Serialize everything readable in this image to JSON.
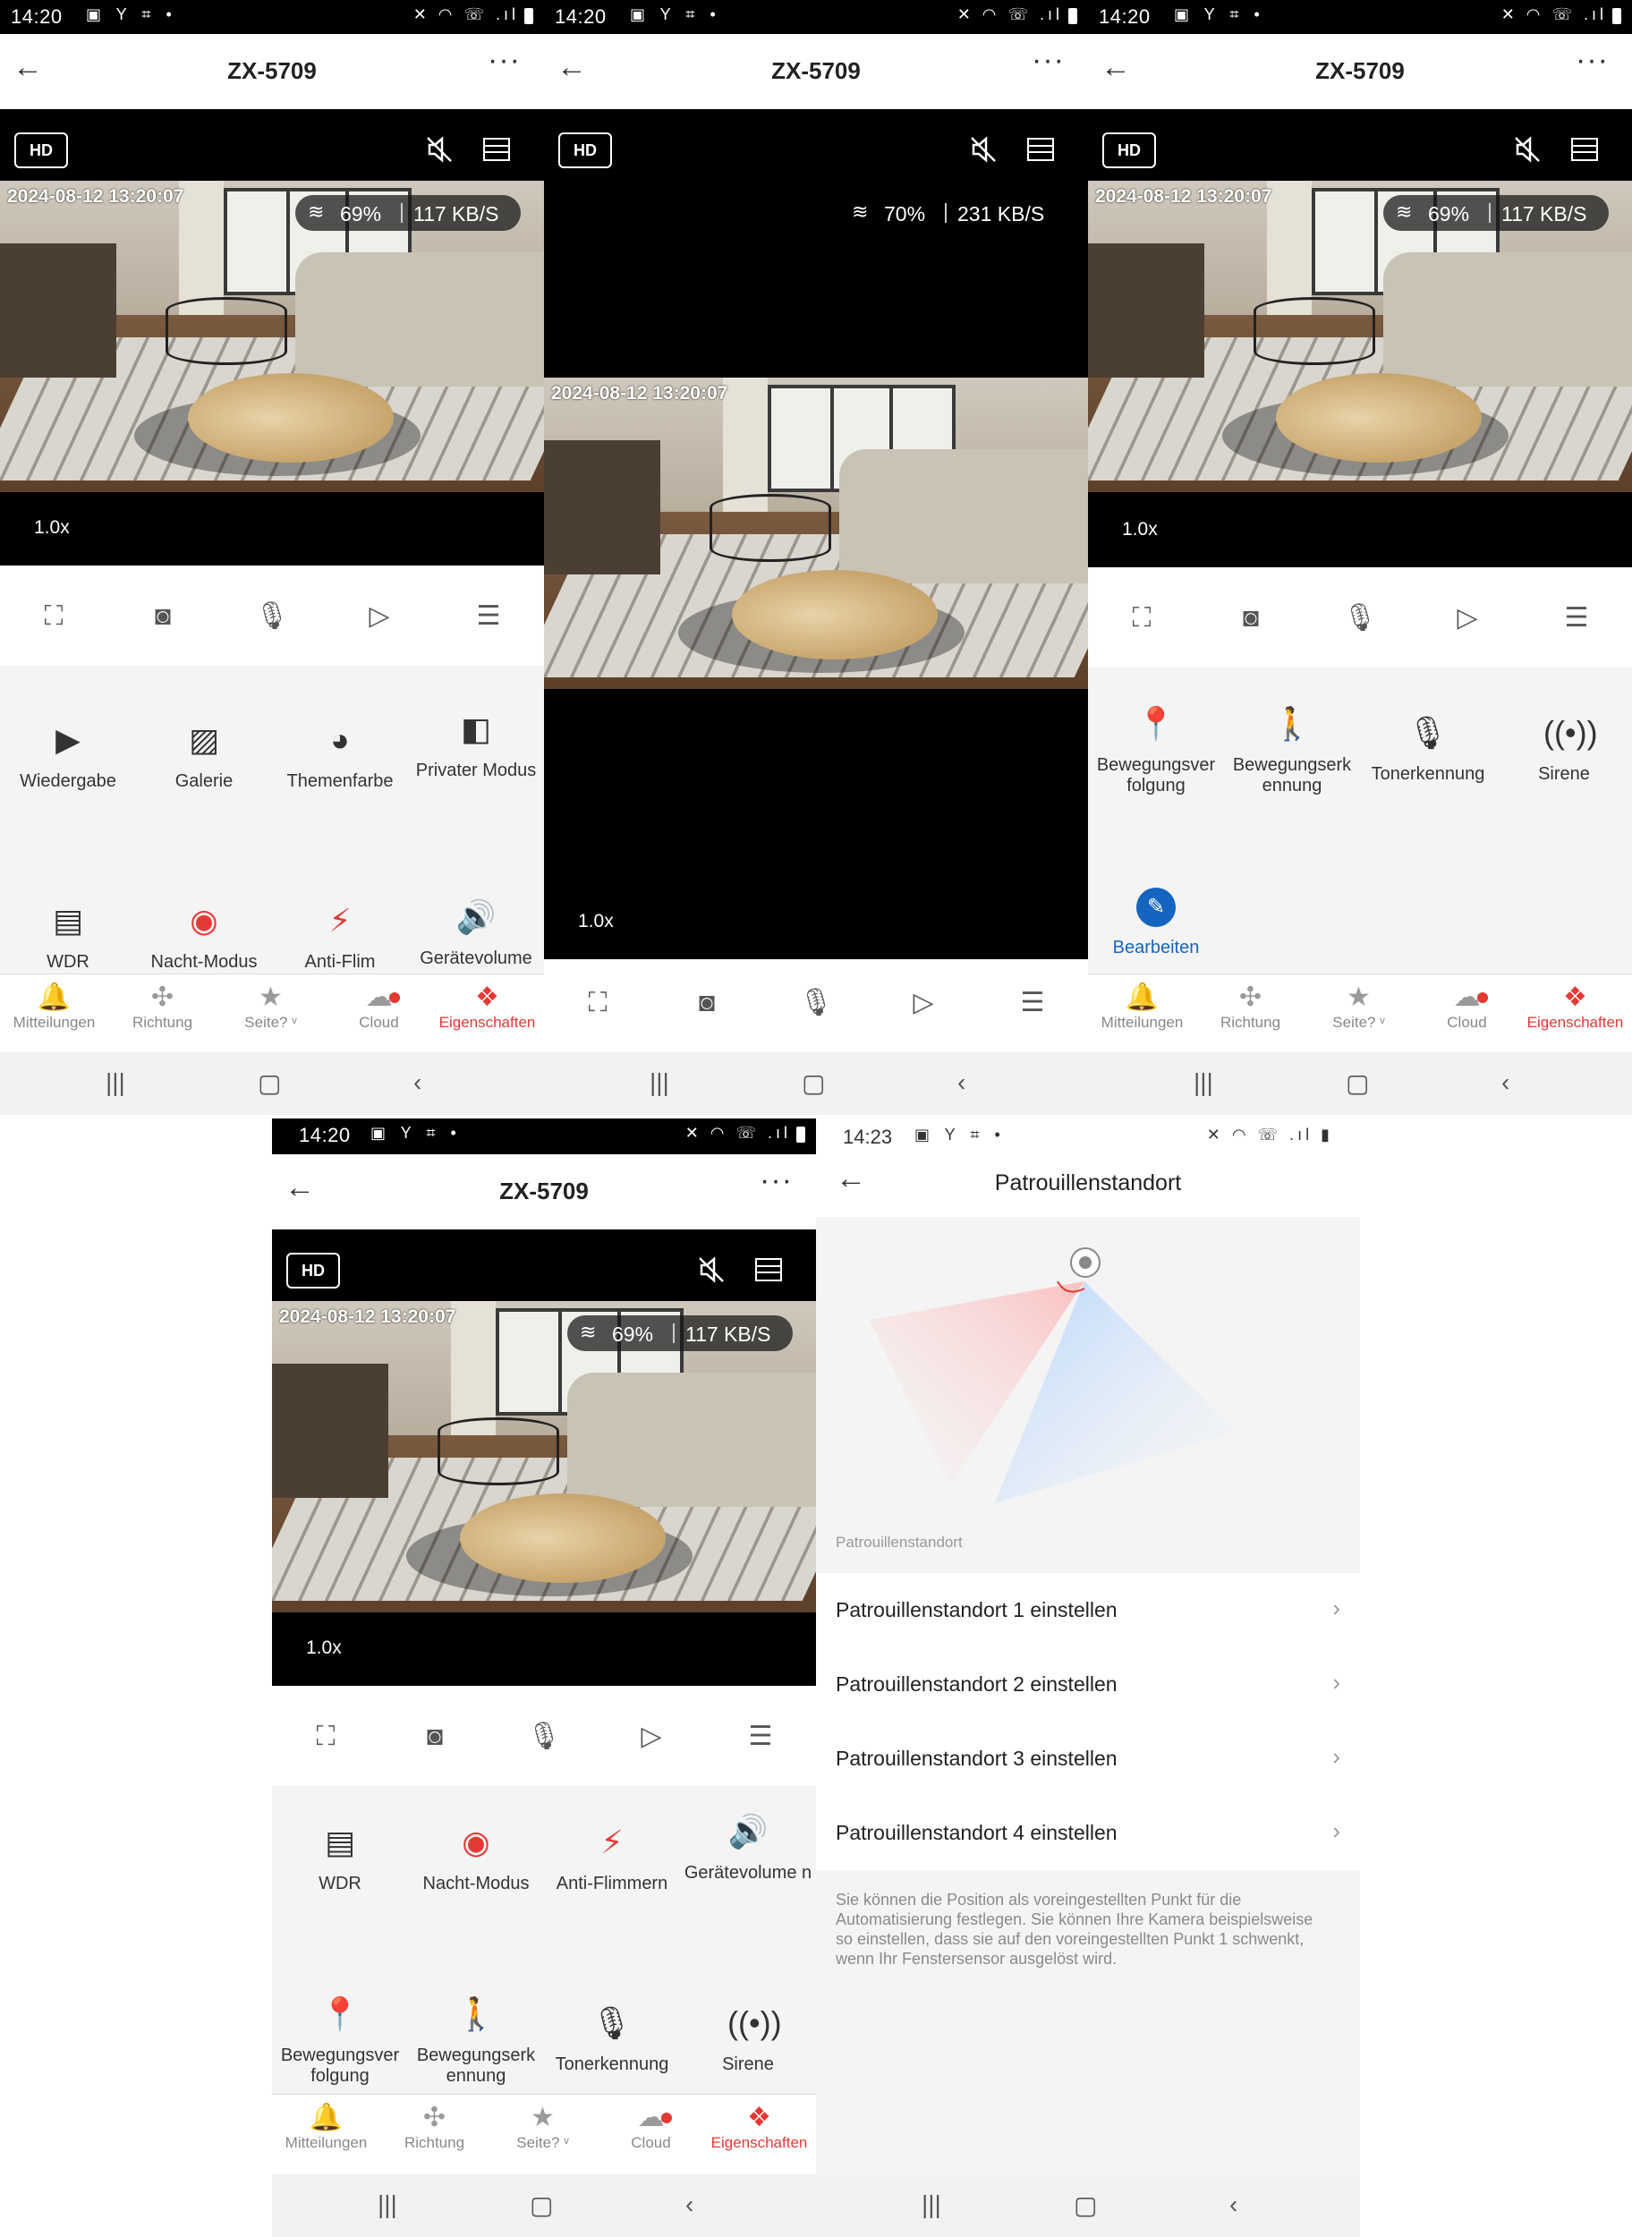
{
  "status": {
    "time": "14:20",
    "time_last": "14:23"
  },
  "appbar": {
    "title": "ZX-5709"
  },
  "video": {
    "quality": "HD",
    "timestamp": "2024-08-12   13:20:07",
    "signal_a": "69%",
    "rate_a": "117 KB/S",
    "signal_b": "70%",
    "rate_b": "231 KB/S",
    "zoom": "1.0x"
  },
  "features": {
    "wiedergabe": "Wiedergabe",
    "galerie": "Galerie",
    "themenfarbe": "Themenfarbe",
    "privater_modus": "Privater Modus",
    "wdr": "WDR",
    "nacht_modus": "Nacht-Modus",
    "anti_flimmern": "Anti-Flimmern",
    "geraetevolume": "Gerätevolume n",
    "geraetevolume_partial": "Gerätevolume",
    "bewegungsverfolgung": "Bewegungsver folgung",
    "bewegungserkennung": "Bewegungserk ennung",
    "tonerkennung": "Tonerkennung",
    "sirene": "Sirene",
    "bearbeiten": "Bearbeiten",
    "wdr_partial": "WDR",
    "nacht_partial": "Nacht-Modus",
    "anti_partial": "Anti-Flim"
  },
  "tabs": {
    "mitteilungen": "Mitteilungen",
    "richtung": "Richtung",
    "seite": "Seite? ᵛ",
    "cloud": "Cloud",
    "eigenschaften": "Eigenschaften"
  },
  "patrol": {
    "title": "Patrouillenstandort",
    "section_label": "Patrouillenstandort",
    "items": [
      "Patrouillenstandort 1 einstellen",
      "Patrouillenstandort 2 einstellen",
      "Patrouillenstandort 3 einstellen",
      "Patrouillenstandort 4 einstellen"
    ],
    "hint": "Sie können die Position als voreingestellten Punkt für die Automatisierung festlegen. Sie können Ihre Kamera beispielsweise so einstellen, dass sie auf den voreingestellten Punkt 1 schwenkt, wenn Ihr Fenstersensor ausgelöst wird."
  },
  "colors": {
    "accent": "#e53935",
    "edit_blue": "#1565c0"
  }
}
